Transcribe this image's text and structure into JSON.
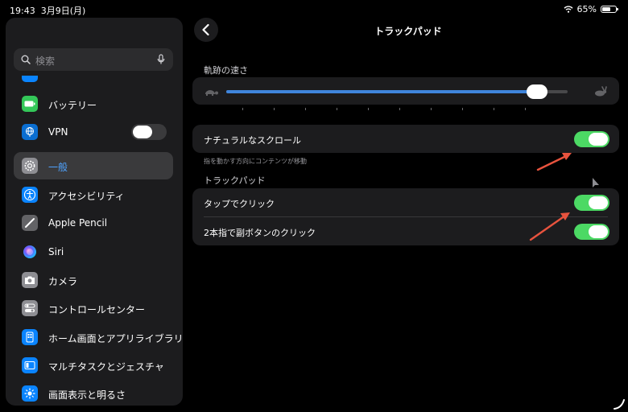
{
  "status": {
    "time": "19:43",
    "date": "3月9日(月)",
    "battery_percent": "65%",
    "battery_level": 0.65
  },
  "sidebar": {
    "search_placeholder": "検索",
    "items": [
      {
        "label": "バッテリー",
        "icon": "battery-icon",
        "color": "#34c759"
      },
      {
        "label": "VPN",
        "icon": "globe-icon",
        "color": "#0a6ed1",
        "toggle": "off"
      },
      {
        "label": "一般",
        "icon": "gear-icon",
        "color": "#8e8e93",
        "selected": true
      },
      {
        "label": "アクセシビリティ",
        "icon": "accessibility-icon",
        "color": "#0a84ff"
      },
      {
        "label": "Apple Pencil",
        "icon": "pencil-icon",
        "color": "#636366"
      },
      {
        "label": "Siri",
        "icon": "siri-icon",
        "color": "#1c1c1e"
      },
      {
        "label": "カメラ",
        "icon": "camera-icon",
        "color": "#8e8e93"
      },
      {
        "label": "コントロールセンター",
        "icon": "switches-icon",
        "color": "#8e8e93"
      },
      {
        "label": "ホーム画面とアプリライブラリ",
        "icon": "home-screen-icon",
        "color": "#0a84ff"
      },
      {
        "label": "マルチタスクとジェスチャ",
        "icon": "multitask-icon",
        "color": "#0a84ff"
      },
      {
        "label": "画面表示と明るさ",
        "icon": "brightness-icon",
        "color": "#0a84ff"
      }
    ]
  },
  "main": {
    "title": "トラックパッド",
    "speed": {
      "label": "軌跡の速さ",
      "value": 0.91
    },
    "scroll": {
      "label": "ナチュラルなスクロール",
      "caption": "指を動かす方向にコンテンツが移動",
      "toggle": "on"
    },
    "trackpad_section": "トラックパッド",
    "tap": {
      "label": "タップでクリック",
      "toggle": "on"
    },
    "secondary": {
      "label": "2本指で副ボタンのクリック",
      "toggle": "on"
    }
  },
  "colors": {
    "accent_green": "#4cd964",
    "slider_blue": "#3f85dc",
    "arrow_red": "#e8533e"
  }
}
